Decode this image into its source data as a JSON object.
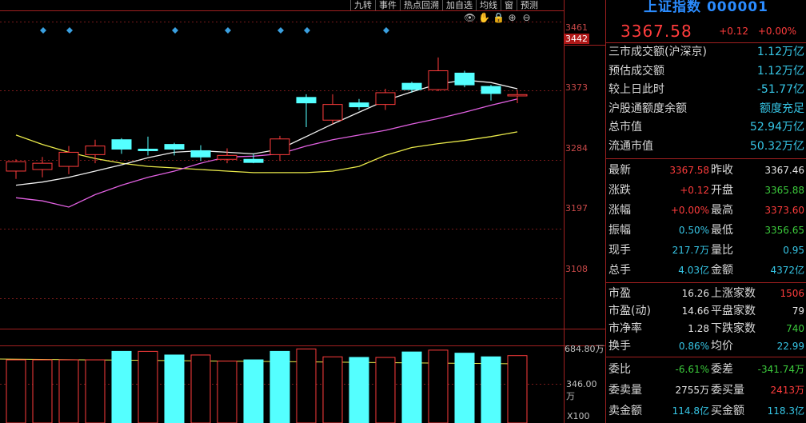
{
  "toolbar": {
    "buttons": [
      "九转",
      "事件",
      "热点回溯",
      "加自选",
      "均线",
      "窗",
      "预测"
    ]
  },
  "price_axis": {
    "labels": [
      "3461",
      "3442",
      "3373",
      "3284",
      "3197",
      "3108"
    ]
  },
  "volume_axis": {
    "labels": [
      "684.80万",
      "346.00万",
      "X100"
    ]
  },
  "panel": {
    "title": "上证指数 000001",
    "price": "3367.58",
    "change": "+0.12",
    "change_pct": "+0.00%",
    "info": [
      {
        "label": "三市成交额(沪深京)",
        "value": "1.12万亿"
      },
      {
        "label": "预估成交额",
        "value": "1.12万亿"
      },
      {
        "label": "较上日此时",
        "value": "-51.77亿"
      },
      {
        "label": "沪股通额度余额",
        "value": "额度充足"
      },
      {
        "label": "总市值",
        "value": "52.94万亿"
      },
      {
        "label": "流通市值",
        "value": "50.32万亿"
      }
    ],
    "stats": [
      {
        "l1": "最新",
        "v1": "3367.58",
        "c1": "red",
        "l2": "昨收",
        "v2": "3367.46",
        "c2": "white"
      },
      {
        "l1": "涨跌",
        "v1": "+0.12",
        "c1": "red",
        "l2": "开盘",
        "v2": "3365.88",
        "c2": "green"
      },
      {
        "l1": "涨幅",
        "v1": "+0.00%",
        "c1": "red",
        "l2": "最高",
        "v2": "3373.60",
        "c2": "red"
      },
      {
        "l1": "振幅",
        "v1": "0.50%",
        "c1": "cyan",
        "l2": "最低",
        "v2": "3356.65",
        "c2": "green"
      },
      {
        "l1": "现手",
        "v1": "217.7万",
        "c1": "cyan",
        "l2": "量比",
        "v2": "0.95",
        "c2": "cyan"
      },
      {
        "l1": "总手",
        "v1": "4.03亿",
        "c1": "cyan",
        "l2": "金额",
        "v2": "4372亿",
        "c2": "cyan"
      }
    ],
    "market": [
      {
        "l1": "市盈",
        "v1": "16.26",
        "c1": "white",
        "l2": "上涨家数",
        "v2": "1506",
        "c2": "red"
      },
      {
        "l1": "市盈(动)",
        "v1": "14.66",
        "c1": "white",
        "l2": "平盘家数",
        "v2": "79",
        "c2": "white"
      },
      {
        "l1": "市净率",
        "v1": "1.28",
        "c1": "white",
        "l2": "下跌家数",
        "v2": "740",
        "c2": "green"
      },
      {
        "l1": "换手",
        "v1": "0.86%",
        "c1": "cyan",
        "l2": "均价",
        "v2": "22.99",
        "c2": "cyan"
      }
    ],
    "orders": [
      {
        "l1": "委比",
        "v1": "-6.61%",
        "c1": "green",
        "l2": "委差",
        "v2": "-341.74万",
        "c2": "green"
      },
      {
        "l1": "委卖量",
        "v1": "2755万",
        "c1": "white",
        "l2": "委买量",
        "v2": "2413万",
        "c2": "red"
      },
      {
        "l1": "卖金额",
        "v1": "114.8亿",
        "c1": "cyan",
        "l2": "买金额",
        "v2": "118.3亿",
        "c2": "cyan"
      }
    ]
  },
  "chart_data": {
    "type": "candlestick",
    "ylim": [
      3070,
      3475
    ],
    "candles": [
      {
        "o": 3270,
        "h": 3285,
        "l": 3260,
        "c": 3282
      },
      {
        "o": 3272,
        "h": 3288,
        "l": 3262,
        "c": 3280
      },
      {
        "o": 3276,
        "h": 3302,
        "l": 3266,
        "c": 3294
      },
      {
        "o": 3291,
        "h": 3310,
        "l": 3280,
        "c": 3302
      },
      {
        "o": 3310,
        "h": 3312,
        "l": 3292,
        "c": 3298
      },
      {
        "o": 3298,
        "h": 3314,
        "l": 3290,
        "c": 3296
      },
      {
        "o": 3304,
        "h": 3306,
        "l": 3290,
        "c": 3298
      },
      {
        "o": 3296,
        "h": 3303,
        "l": 3283,
        "c": 3288
      },
      {
        "o": 3285,
        "h": 3299,
        "l": 3280,
        "c": 3290
      },
      {
        "o": 3285,
        "h": 3292,
        "l": 3280,
        "c": 3281
      },
      {
        "o": 3291,
        "h": 3315,
        "l": 3283,
        "c": 3311
      },
      {
        "o": 3364,
        "h": 3368,
        "l": 3326,
        "c": 3357
      },
      {
        "o": 3335,
        "h": 3368,
        "l": 3330,
        "c": 3355
      },
      {
        "o": 3357,
        "h": 3362,
        "l": 3348,
        "c": 3352
      },
      {
        "o": 3355,
        "h": 3375,
        "l": 3348,
        "c": 3370
      },
      {
        "o": 3382,
        "h": 3384,
        "l": 3370,
        "c": 3374
      },
      {
        "o": 3374,
        "h": 3415,
        "l": 3372,
        "c": 3398
      },
      {
        "o": 3395,
        "h": 3398,
        "l": 3377,
        "c": 3380
      },
      {
        "o": 3378,
        "h": 3380,
        "l": 3360,
        "c": 3369
      },
      {
        "o": 3365.88,
        "h": 3373.6,
        "l": 3356.65,
        "c": 3367.58
      }
    ],
    "ma_short": [
      3252,
      3256,
      3262,
      3270,
      3278,
      3287,
      3294,
      3296,
      3294,
      3292,
      3298,
      3314,
      3330,
      3345,
      3360,
      3371,
      3381,
      3386,
      3383,
      3375
    ],
    "ma_mid": [
      3236,
      3232,
      3224,
      3240,
      3252,
      3262,
      3270,
      3280,
      3288,
      3289,
      3292,
      3302,
      3310,
      3316,
      3322,
      3330,
      3337,
      3345,
      3354,
      3362
    ],
    "ma_long": [
      3316,
      3304,
      3294,
      3286,
      3280,
      3276,
      3274,
      3272,
      3270,
      3268,
      3268,
      3268,
      3270,
      3276,
      3290,
      3300,
      3305,
      3309,
      3314,
      3320
    ],
    "volume_max": 684.8,
    "volumes": [
      520,
      520,
      520,
      520,
      590,
      590,
      560,
      560,
      510,
      520,
      590,
      610,
      545,
      540,
      540,
      585,
      600,
      575,
      545,
      555
    ],
    "vol_red": [
      true,
      true,
      true,
      true,
      false,
      true,
      false,
      true,
      true,
      false,
      false,
      true,
      true,
      false,
      true,
      false,
      true,
      false,
      false,
      true
    ],
    "diamond_candles": [
      1,
      2,
      6,
      8,
      10,
      11,
      14
    ]
  }
}
